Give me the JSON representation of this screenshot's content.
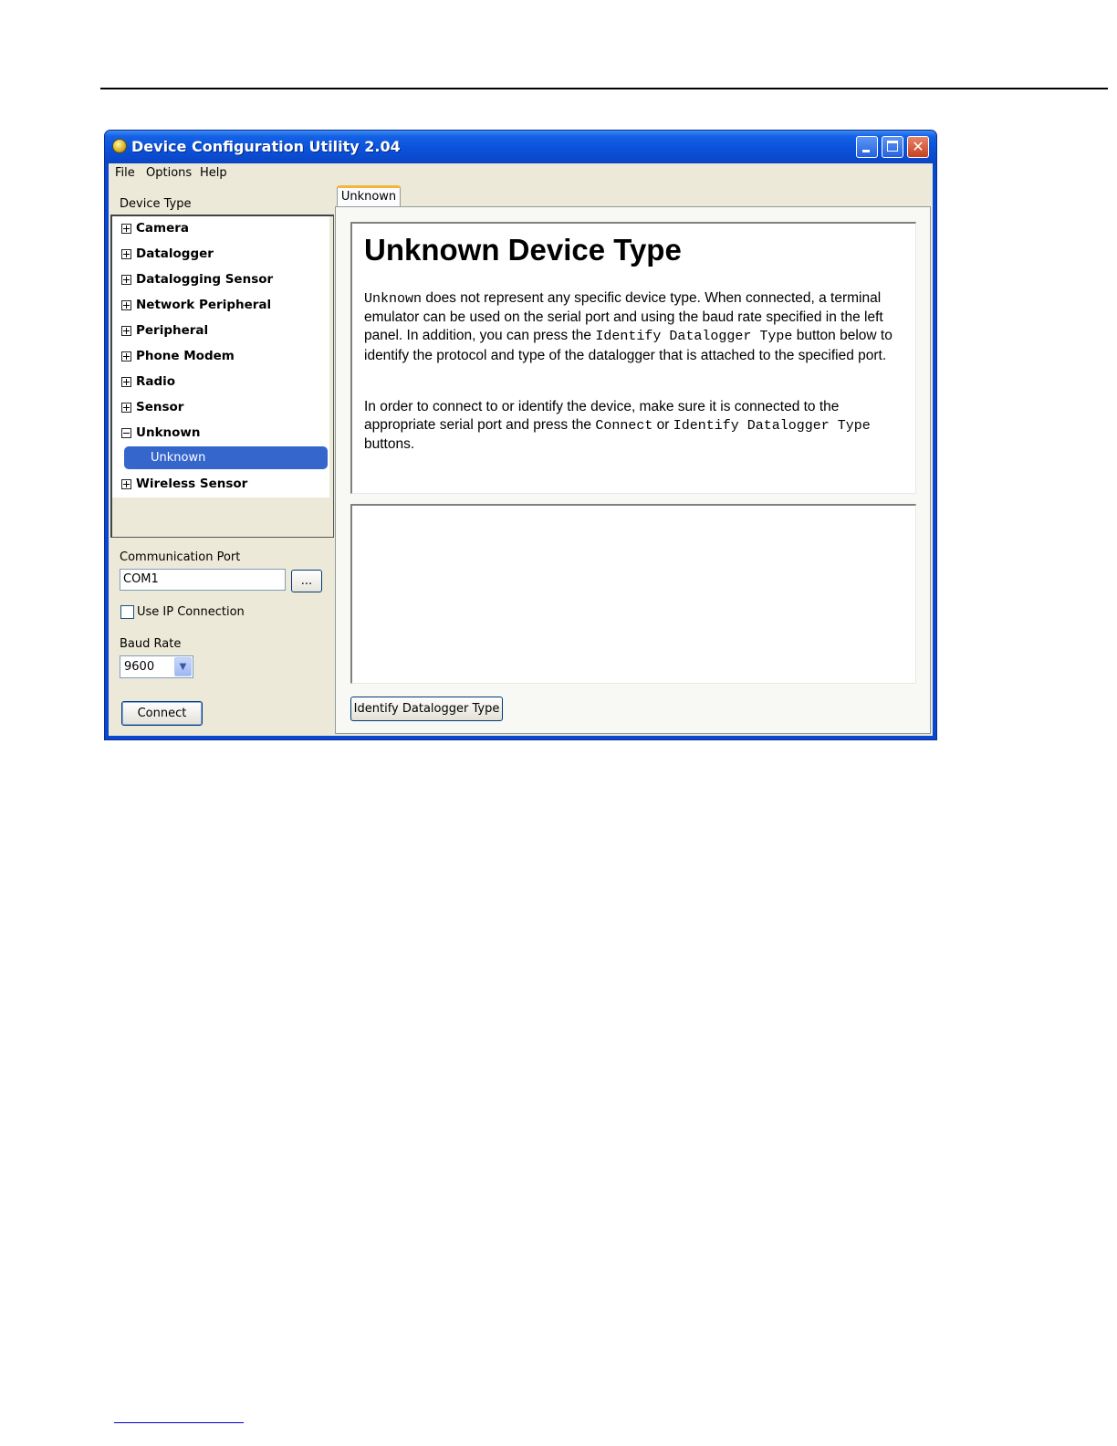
{
  "window": {
    "title": "Device Configuration Utility 2.04",
    "close_glyph": "✕"
  },
  "menu": [
    "File",
    "Options",
    "Help"
  ],
  "left_panel": {
    "device_type_label": "Device Type",
    "tree": [
      {
        "label": "Camera",
        "expanded": false
      },
      {
        "label": "Datalogger",
        "expanded": false
      },
      {
        "label": "Datalogging Sensor",
        "expanded": false
      },
      {
        "label": "Network Peripheral",
        "expanded": false
      },
      {
        "label": "Peripheral",
        "expanded": false
      },
      {
        "label": "Phone Modem",
        "expanded": false
      },
      {
        "label": "Radio",
        "expanded": false
      },
      {
        "label": "Sensor",
        "expanded": false
      },
      {
        "label": "Unknown",
        "expanded": true,
        "children": [
          "Unknown"
        ]
      },
      {
        "label": "Wireless Sensor",
        "expanded": false
      }
    ],
    "selected_child": "Unknown",
    "comm_port_label": "Communication Port",
    "comm_port_value": "COM1",
    "browse_label": "...",
    "use_ip_label": "Use IP Connection",
    "use_ip_checked": false,
    "baud_rate_label": "Baud Rate",
    "baud_rate_value": "9600",
    "connect_label": "Connect"
  },
  "right_panel": {
    "tab_label": "Unknown",
    "heading": "Unknown Device Type",
    "para1": {
      "code1": "Unknown",
      "t1": " does not represent any specific device type. When connected, a terminal emulator can be used on the serial port and using the baud rate specified in the left panel. In addition, you can press the ",
      "code2": "Identify Datalogger Type",
      "t2": " button below to identify the protocol and type of the datalogger that is attached to the specified port."
    },
    "para2": {
      "t1": "In order to connect to or identify the device, make sure it is connected to the appropriate serial port and press the ",
      "code1": "Connect",
      "t2": " or ",
      "code2": "Identify Datalogger Type",
      "t3": " buttons."
    },
    "identify_button_label": "Identify Datalogger Type"
  },
  "colors": {
    "titlebar": "#0a52db",
    "selection": "#3466cc",
    "tab_accent": "#f3b63c",
    "footer_rule": "#0000cc"
  }
}
